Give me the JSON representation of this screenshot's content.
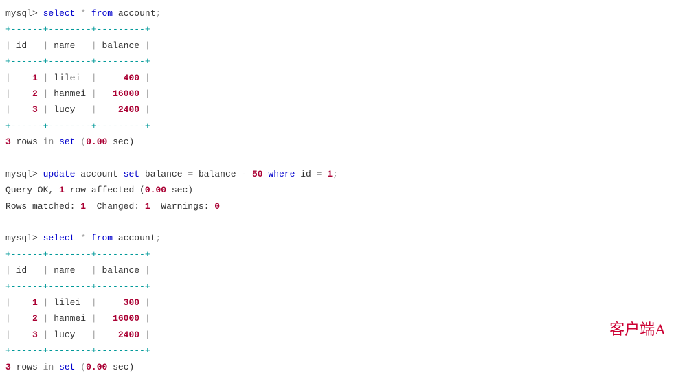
{
  "prompt": "mysql>",
  "q1": {
    "kw1": "select",
    "star": "*",
    "kw2": "from",
    "tbl": "account",
    "end": ";"
  },
  "tbl1": {
    "border": "+------+--------+---------+",
    "h_id": "id",
    "h_name": "name",
    "h_bal": "balance",
    "r1_id": "1",
    "r1_name": "lilei",
    "r1_bal": "400",
    "r2_id": "2",
    "r2_name": "hanmei",
    "r2_bal": "16000",
    "r3_id": "3",
    "r3_name": "lucy",
    "r3_bal": "2400"
  },
  "status1": {
    "n": "3",
    "rows": "rows",
    "in": "in",
    "set": "set",
    "op": "(",
    "t": "0.00",
    "cp": " sec)"
  },
  "q2": {
    "kw1": "update",
    "tbl": "account",
    "kw2": "set",
    "col1": "balance",
    "eq1": "=",
    "col2": "balance",
    "minus": "-",
    "v1": "50",
    "kw3": "where",
    "col3": "id",
    "eq2": "=",
    "v2": "1",
    "end": ";"
  },
  "res2": {
    "l1a": "Query OK, ",
    "l1b": "1",
    "l1c": " row affected (",
    "l1d": "0.00",
    "l1e": " sec)",
    "l2a": "Rows matched: ",
    "l2b": "1",
    "l2c": "  Changed: ",
    "l2d": "1",
    "l2e": "  Warnings: ",
    "l2f": "0"
  },
  "q3": {
    "kw1": "select",
    "star": "*",
    "kw2": "from",
    "tbl": "account",
    "end": ";"
  },
  "tbl2": {
    "border": "+------+--------+---------+",
    "h_id": "id",
    "h_name": "name",
    "h_bal": "balance",
    "r1_id": "1",
    "r1_name": "lilei",
    "r1_bal": "300",
    "r2_id": "2",
    "r2_name": "hanmei",
    "r2_bal": "16000",
    "r3_id": "3",
    "r3_name": "lucy",
    "r3_bal": "2400"
  },
  "status2": {
    "n": "3",
    "rows": "rows",
    "in": "in",
    "set": "set",
    "op": "(",
    "t": "0.00",
    "cp": " sec)"
  },
  "client_label": "客户端A"
}
